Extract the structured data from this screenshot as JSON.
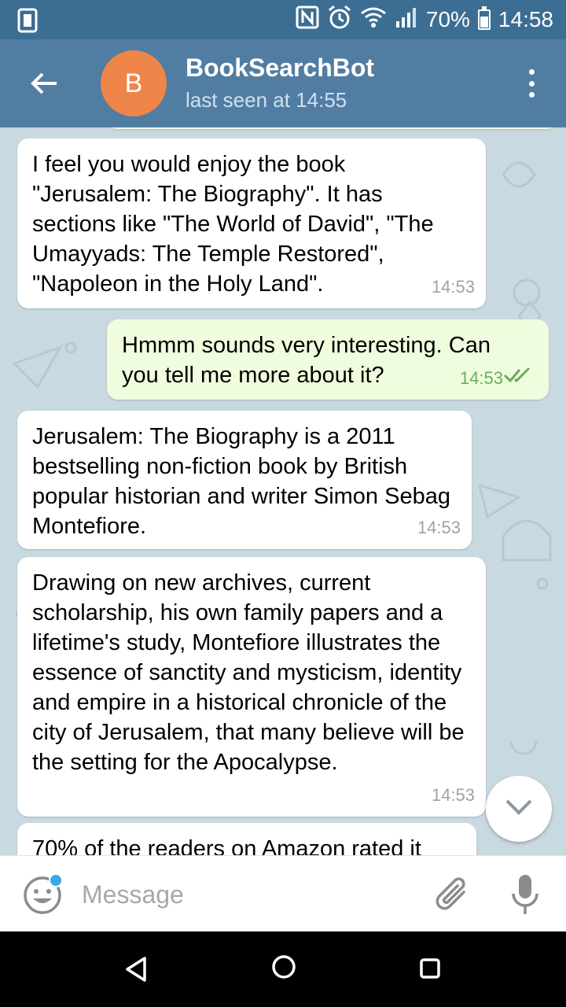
{
  "status_bar": {
    "battery_percent": "70%",
    "time": "14:58",
    "icons": [
      "device-icon",
      "nfc-icon",
      "alarm-icon",
      "wifi-icon",
      "signal-icon",
      "battery-icon"
    ]
  },
  "header": {
    "avatar_letter": "B",
    "title": "BookSearchBot",
    "subtitle": "last seen at 14:55",
    "colors": {
      "bar": "#517da2",
      "status": "#3c6d93",
      "avatar": "#f0854a"
    }
  },
  "messages": [
    {
      "direction": "in",
      "text": "I feel you would enjoy the book \"Jerusalem: The Biography\". It has sections like \"The World of David\", \"The Umayyads: The Temple Restored\", \"Napoleon in the Holy Land\".",
      "time": "14:53"
    },
    {
      "direction": "out",
      "text": "Hmmm sounds very interesting. Can you tell me more about it?",
      "time": "14:53",
      "read": true
    },
    {
      "direction": "in",
      "text": "Jerusalem: The Biography is a 2011 bestselling non-fiction book by British popular historian and writer Simon Sebag Montefiore.",
      "time": "14:53"
    },
    {
      "direction": "in",
      "text": "Drawing on new archives, current scholarship, his own family papers and a lifetime's study, Montefiore illustrates the essence of sanctity and mysticism, identity and empire in a historical chronicle of the city of Jerusalem, that many believe will be the setting for the Apocalypse.",
      "time": "14:53"
    },
    {
      "direction": "in",
      "text": "70% of the readers on Amazon rated it",
      "time": ""
    }
  ],
  "composer": {
    "placeholder": "Message",
    "value": ""
  },
  "theme": {
    "chat_bg": "#c9d9e1",
    "incoming_bubble": "#ffffff",
    "outgoing_bubble": "#effdde",
    "read_check": "#6aad5c"
  }
}
